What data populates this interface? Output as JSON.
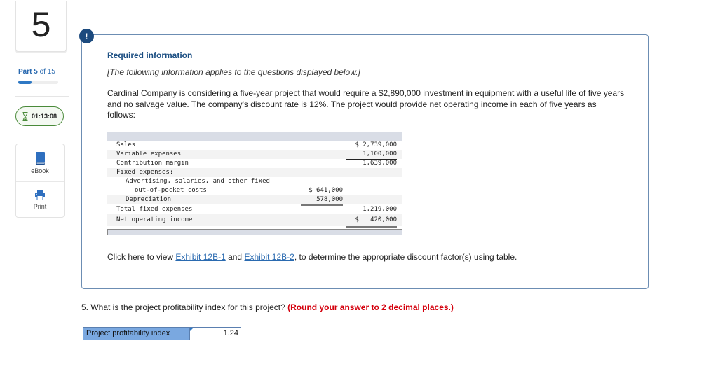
{
  "sidebar": {
    "question_number": "5",
    "part_word": "Part",
    "part_current": "5",
    "part_of": "of 15",
    "progress_fraction": 0.333,
    "timer": "01:13:08",
    "tools": [
      {
        "label": "eBook",
        "icon": "book-icon"
      },
      {
        "label": "Print",
        "icon": "printer-icon"
      }
    ]
  },
  "info": {
    "badge": "!",
    "title": "Required information",
    "subtitle": "[The following information applies to the questions displayed below.]",
    "intro": "Cardinal Company is considering a five-year project that would require a $2,890,000 investment in equipment with a useful life of five years and no salvage value. The company's discount rate is 12%. The project would provide net operating income in each of five years as follows:",
    "table": {
      "rows": [
        {
          "label": "Sales",
          "col1": "",
          "col2": "$ 2,739,000"
        },
        {
          "label": "Variable expenses",
          "col1": "",
          "col2": "1,100,000"
        },
        {
          "label": "Contribution margin",
          "col1": "",
          "col2": "1,639,000"
        },
        {
          "label": "Fixed expenses:",
          "col1": "",
          "col2": ""
        },
        {
          "label": "Advertising, salaries, and other fixed",
          "col1": "",
          "col2": ""
        },
        {
          "label": "out-of-pocket costs",
          "col1": "$ 641,000",
          "col2": ""
        },
        {
          "label": "Depreciation",
          "col1": "578,000",
          "col2": ""
        },
        {
          "label": "Total fixed expenses",
          "col1": "",
          "col2": "1,219,000"
        },
        {
          "label": "Net operating income",
          "col1": "",
          "col2": "$   420,000"
        }
      ]
    },
    "exhibit": {
      "prefix": "Click here to view ",
      "link1": "Exhibit 12B-1",
      "middle": " and ",
      "link2": "Exhibit 12B-2",
      "suffix": ", to determine the appropriate discount factor(s) using table."
    }
  },
  "question": {
    "text": "5. What is the project profitability index for this project? ",
    "instruction": "(Round your answer to 2 decimal places.)"
  },
  "answer": {
    "label": "Project profitability index",
    "value": "1.24"
  }
}
